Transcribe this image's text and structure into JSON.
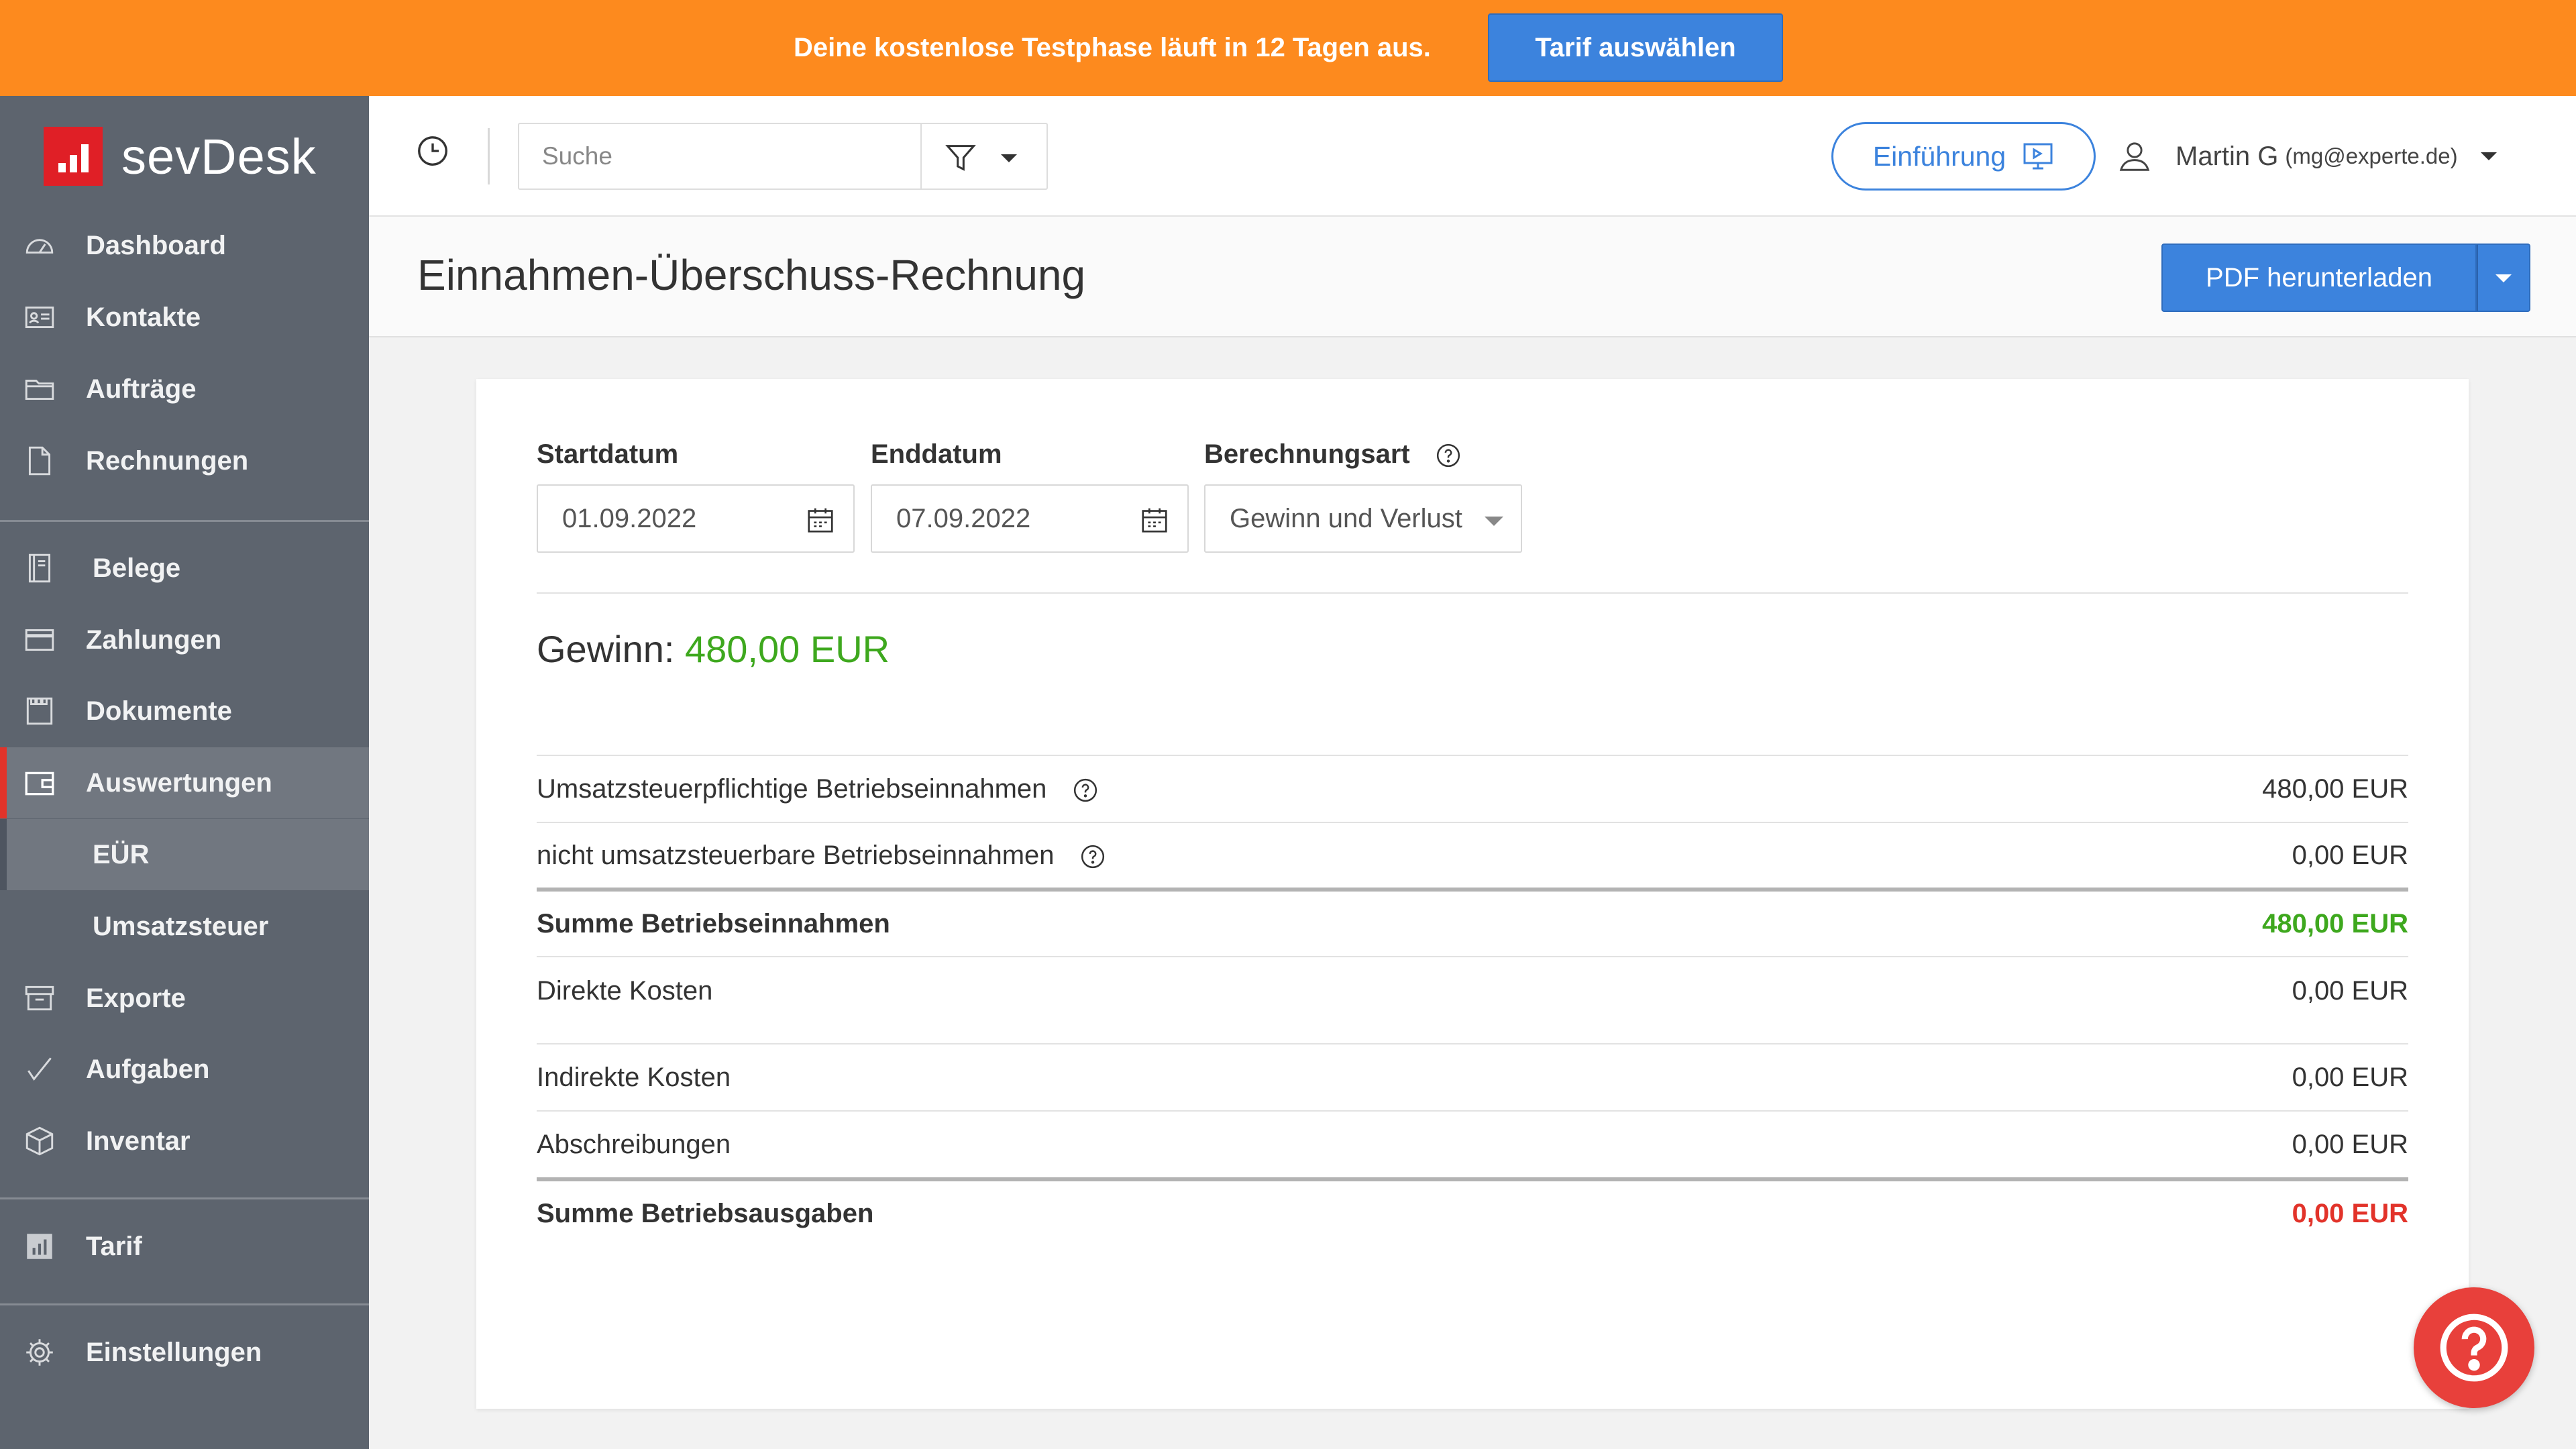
{
  "banner": {
    "text": "Deine kostenlose Testphase läuft in 12 Tagen aus.",
    "button": "Tarif auswählen"
  },
  "brand": {
    "name": "sevDesk"
  },
  "sidebar": {
    "items": [
      {
        "label": "Dashboard",
        "icon": "dashboard-icon"
      },
      {
        "label": "Kontakte",
        "icon": "contact-card-icon"
      },
      {
        "label": "Aufträge",
        "icon": "folder-icon"
      },
      {
        "label": "Rechnungen",
        "icon": "document-icon"
      },
      {
        "label": "Belege",
        "icon": "receipt-icon"
      },
      {
        "label": "Zahlungen",
        "icon": "credit-card-icon"
      },
      {
        "label": "Dokumente",
        "icon": "documents-icon"
      },
      {
        "label": "Auswertungen",
        "icon": "wallet-icon"
      },
      {
        "label": "EÜR"
      },
      {
        "label": "Umsatzsteuer"
      },
      {
        "label": "Exporte",
        "icon": "archive-box-icon"
      },
      {
        "label": "Aufgaben",
        "icon": "checkmark-icon"
      },
      {
        "label": "Inventar",
        "icon": "cube-icon"
      },
      {
        "label": "Tarif",
        "icon": "bar-chart-icon"
      },
      {
        "label": "Einstellungen",
        "icon": "gear-icon"
      }
    ]
  },
  "topbar": {
    "search_placeholder": "Suche",
    "intro_button": "Einführung",
    "user_name": "Martin G",
    "user_email": "(mg@experte.de)"
  },
  "page": {
    "title": "Einnahmen-Überschuss-Rechnung",
    "pdf_button": "PDF herunterladen"
  },
  "form": {
    "start_label": "Startdatum",
    "start_value": "01.09.2022",
    "end_label": "Enddatum",
    "end_value": "07.09.2022",
    "calc_label": "Berechnungsart",
    "calc_value": "Gewinn und Verlust"
  },
  "summary": {
    "profit_label": "Gewinn:",
    "profit_value": "480,00 EUR"
  },
  "rows": [
    {
      "label": "Umsatzsteuerpflichtige Betriebseinnahmen",
      "amount": "480,00 EUR"
    },
    {
      "label": "nicht umsatzsteuerbare Betriebseinnahmen",
      "amount": "0,00 EUR"
    },
    {
      "label": "Summe Betriebseinnahmen",
      "amount": "480,00 EUR"
    },
    {
      "label": "Direkte Kosten",
      "amount": "0,00 EUR"
    },
    {
      "label": "Indirekte Kosten",
      "amount": "0,00 EUR"
    },
    {
      "label": "Abschreibungen",
      "amount": "0,00 EUR"
    },
    {
      "label": "Summe Betriebsausgaben",
      "amount": "0,00 EUR"
    }
  ],
  "colors": {
    "banner": "#fd8a1e",
    "primary": "#3c83dd",
    "sidebar": "#5d646e",
    "active_accent": "#e2332a",
    "positive": "#3ea81e",
    "negative": "#e2332a"
  }
}
